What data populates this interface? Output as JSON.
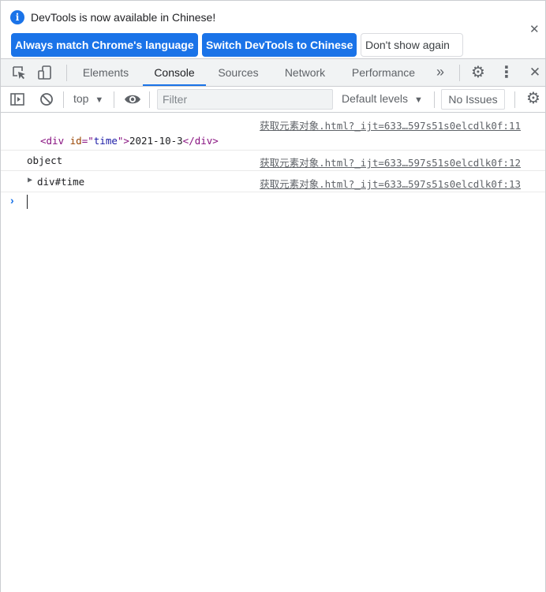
{
  "infobar": {
    "message": "DevTools is now available in Chinese!",
    "info_icon": "i",
    "buttons": {
      "always_match": "Always match Chrome's language",
      "switch": "Switch DevTools to Chinese",
      "dont_show": "Don't show again"
    },
    "close": "✕"
  },
  "tabs": [
    {
      "label": "Elements",
      "active": false
    },
    {
      "label": "Console",
      "active": true
    },
    {
      "label": "Sources",
      "active": false
    },
    {
      "label": "Network",
      "active": false
    },
    {
      "label": "Performance",
      "active": false
    }
  ],
  "tabbar_icons": {
    "more_tabs": "»",
    "settings": "⚙",
    "kebab": "⋮",
    "close": "✕"
  },
  "console_toolbar": {
    "context": "top",
    "context_arrow": "▼",
    "filter_placeholder": "Filter",
    "levels": "Default levels",
    "levels_arrow": "▼",
    "issues": "No Issues"
  },
  "messages": [
    {
      "source": "获取元素对象.html?_ijt=633…597s51s0elcdlk0f:11",
      "element": {
        "open": "<div",
        "attr_name": "id",
        "eq": "=\"",
        "attr_value": "time",
        "close_quote": "\">",
        "text": "2021-10-3",
        "end": "</div>"
      }
    },
    {
      "source": "获取元素对象.html?_ijt=633…597s51s0elcdlk0f:12",
      "text": "object"
    },
    {
      "source": "获取元素对象.html?_ijt=633…597s51s0elcdlk0f:13",
      "expander": "▶",
      "text": "div#time"
    }
  ],
  "prompt": "›",
  "colors": {
    "accent": "#1a73e8",
    "tag": "#881280",
    "attr": "#994500",
    "attr_value": "#1a1aa6"
  }
}
